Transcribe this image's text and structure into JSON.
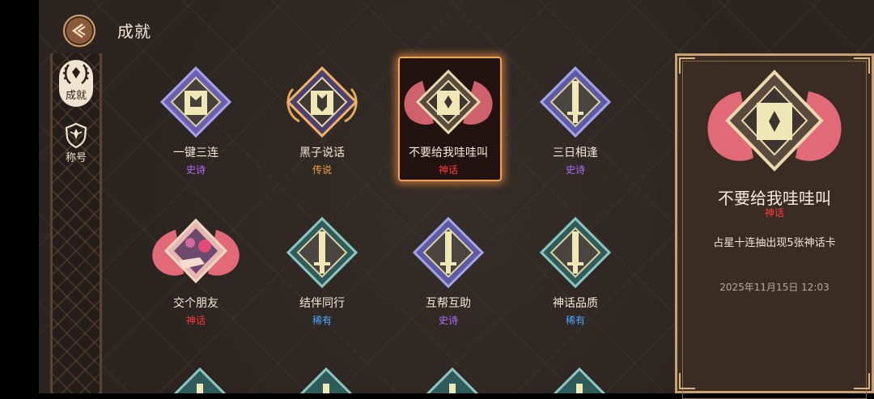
{
  "page": {
    "title": "成就"
  },
  "sidebar": {
    "items": [
      {
        "label": "成就",
        "icon": "laurel-wreath-icon",
        "active": true
      },
      {
        "label": "称号",
        "icon": "shield-icon",
        "active": false
      }
    ]
  },
  "rarity_colors": {
    "史诗": "#b46cff",
    "传说": "#f1a23a",
    "神话": "#ff3b3b",
    "稀有": "#4aa6ff"
  },
  "achievements": [
    {
      "name": "一键三连",
      "rarity": "史诗",
      "color": "#b46cff"
    },
    {
      "name": "黑子说话",
      "rarity": "传说",
      "color": "#f1a23a"
    },
    {
      "name": "不要给我哇哇叫",
      "rarity": "神话",
      "color": "#ff3b3b",
      "selected": true
    },
    {
      "name": "三日相逢",
      "rarity": "史诗",
      "color": "#b46cff"
    },
    {
      "name": "交个朋友",
      "rarity": "神话",
      "color": "#ff3b3b"
    },
    {
      "name": "结伴同行",
      "rarity": "稀有",
      "color": "#4aa6ff"
    },
    {
      "name": "互帮互助",
      "rarity": "史诗",
      "color": "#b46cff"
    },
    {
      "name": "神话品质",
      "rarity": "稀有",
      "color": "#4aa6ff"
    }
  ],
  "detail": {
    "title": "不要给我哇哇叫",
    "rarity": "神话",
    "description": "占星十连抽出现5张神话卡",
    "timestamp": "2025年11月15日 12:03"
  }
}
